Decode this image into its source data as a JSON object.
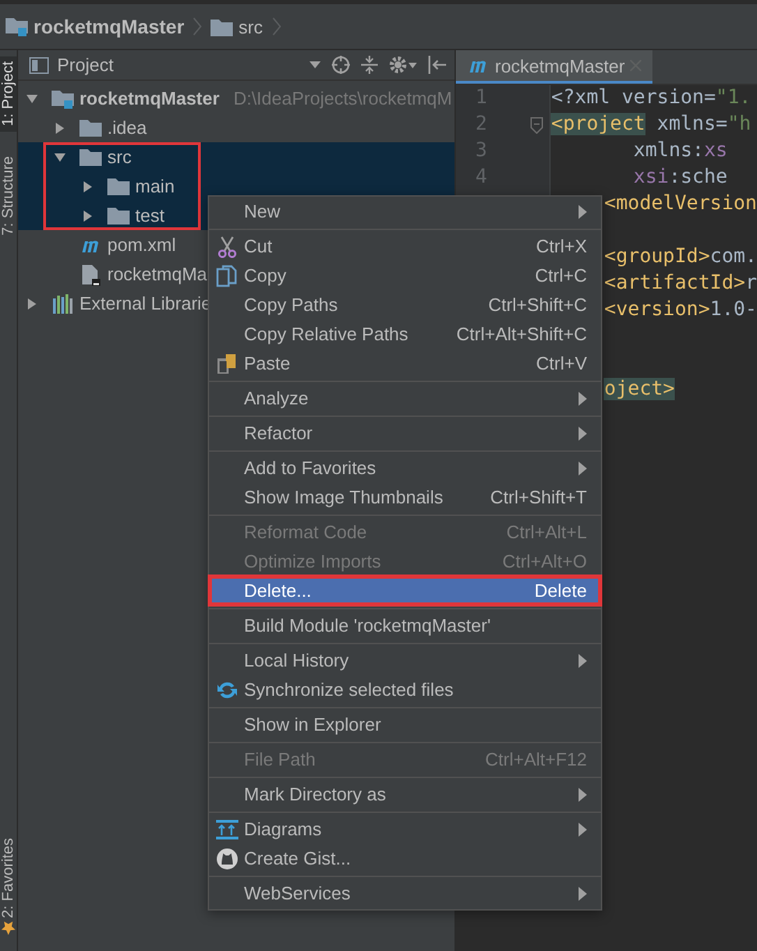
{
  "breadcrumb": [
    {
      "kind": "module",
      "label": "rocketmqMaster"
    },
    {
      "kind": "folder",
      "label": "src"
    }
  ],
  "tool_strip": [
    {
      "label": "1: Project",
      "selected": true,
      "kind": "project"
    },
    {
      "label": "7: Structure",
      "selected": false,
      "kind": "structure"
    },
    {
      "label": "2: Favorites",
      "selected": false,
      "kind": "favorites"
    }
  ],
  "project": {
    "title": "Project",
    "tree": [
      {
        "kind": "module",
        "label": "rocketmqMaster",
        "path": "D:\\IdeaProjects\\rocketmqM",
        "expanded": true,
        "selected": false,
        "children": [
          {
            "kind": "folder",
            "label": ".idea",
            "expanded": false,
            "selected": false
          },
          {
            "kind": "folder",
            "label": "src",
            "expanded": true,
            "selected": true,
            "annotated": true,
            "children": [
              {
                "kind": "folder",
                "label": "main",
                "expanded": false,
                "selected": true
              },
              {
                "kind": "folder",
                "label": "test",
                "expanded": false,
                "selected": true
              }
            ]
          },
          {
            "kind": "maven",
            "label": "pom.xml",
            "selected": false
          },
          {
            "kind": "iml",
            "label": "rocketmqMa",
            "selected": false
          }
        ]
      },
      {
        "kind": "libraries",
        "label": "External Librarie",
        "expanded": false,
        "selected": false
      }
    ]
  },
  "editor": {
    "tab": {
      "label": "rocketmqMaster",
      "selected": true
    },
    "lines": [
      {
        "number": "1",
        "segments": [
          {
            "kind": "plain",
            "text": "<?xml version="
          },
          {
            "kind": "string",
            "text": "\"1."
          }
        ]
      },
      {
        "number": "2",
        "fold": true,
        "segments": [
          {
            "kind": "tag",
            "text": "<project",
            "highlighted": true
          },
          {
            "kind": "plain",
            "text": " xmlns="
          },
          {
            "kind": "string",
            "text": "\"h"
          }
        ]
      },
      {
        "number": "3",
        "segments": [
          {
            "kind": "plain",
            "text": "       xmlns:"
          },
          {
            "kind": "ns",
            "text": "xs"
          }
        ]
      },
      {
        "number": "4",
        "segments": [
          {
            "kind": "ns",
            "text": "       xsi"
          },
          {
            "kind": "plain",
            "text": ":sche"
          }
        ]
      }
    ],
    "lines_beside_menu": [
      {
        "kind": "code",
        "segments": [
          {
            "kind": "tag",
            "text": "<modelVersion"
          }
        ]
      },
      {
        "kind": "blank"
      },
      {
        "kind": "code",
        "segments": [
          {
            "kind": "tag",
            "text": "<groupId>"
          },
          {
            "kind": "plain",
            "text": "com."
          }
        ]
      },
      {
        "kind": "code",
        "segments": [
          {
            "kind": "tag",
            "text": "<artifactId>"
          },
          {
            "kind": "plain",
            "text": "r"
          }
        ]
      },
      {
        "kind": "code",
        "segments": [
          {
            "kind": "tag",
            "text": "<version>"
          },
          {
            "kind": "plain",
            "text": "1.0-"
          }
        ]
      },
      {
        "kind": "blank"
      },
      {
        "kind": "blank"
      },
      {
        "kind": "code",
        "segments": [
          {
            "kind": "tag",
            "text": "oject>",
            "highlighted": true
          }
        ]
      }
    ]
  },
  "context_menu": {
    "items": [
      {
        "kind": "item",
        "label": "New",
        "submenu": true,
        "disabled": false,
        "selected": false
      },
      {
        "kind": "separator"
      },
      {
        "kind": "item",
        "label": "Cut",
        "shortcut": "Ctrl+X",
        "disabled": false,
        "selected": false
      },
      {
        "kind": "item",
        "label": "Copy",
        "shortcut": "Ctrl+C",
        "disabled": false,
        "selected": false
      },
      {
        "kind": "item",
        "label": "Copy Paths",
        "shortcut": "Ctrl+Shift+C",
        "disabled": false,
        "selected": false
      },
      {
        "kind": "item",
        "label": "Copy Relative Paths",
        "shortcut": "Ctrl+Alt+Shift+C",
        "disabled": false,
        "selected": false
      },
      {
        "kind": "item",
        "label": "Paste",
        "shortcut": "Ctrl+V",
        "disabled": false,
        "selected": false
      },
      {
        "kind": "separator"
      },
      {
        "kind": "item",
        "label": "Analyze",
        "submenu": true,
        "disabled": false,
        "selected": false
      },
      {
        "kind": "separator"
      },
      {
        "kind": "item",
        "label": "Refactor",
        "submenu": true,
        "disabled": false,
        "selected": false
      },
      {
        "kind": "separator"
      },
      {
        "kind": "item",
        "label": "Add to Favorites",
        "submenu": true,
        "disabled": false,
        "selected": false
      },
      {
        "kind": "item",
        "label": "Show Image Thumbnails",
        "shortcut": "Ctrl+Shift+T",
        "disabled": false,
        "selected": false
      },
      {
        "kind": "separator"
      },
      {
        "kind": "item",
        "label": "Reformat Code",
        "shortcut": "Ctrl+Alt+L",
        "disabled": true,
        "selected": false
      },
      {
        "kind": "item",
        "label": "Optimize Imports",
        "shortcut": "Ctrl+Alt+O",
        "disabled": true,
        "selected": false
      },
      {
        "kind": "item",
        "label": "Delete...",
        "shortcut": "Delete",
        "disabled": false,
        "selected": true,
        "annotated": true
      },
      {
        "kind": "separator"
      },
      {
        "kind": "item",
        "label": "Build Module 'rocketmqMaster'",
        "disabled": false,
        "selected": false
      },
      {
        "kind": "separator"
      },
      {
        "kind": "item",
        "label": "Local History",
        "submenu": true,
        "disabled": false,
        "selected": false
      },
      {
        "kind": "item",
        "label": "Synchronize selected files",
        "disabled": false,
        "selected": false
      },
      {
        "kind": "separator"
      },
      {
        "kind": "item",
        "label": "Show in Explorer",
        "disabled": false,
        "selected": false
      },
      {
        "kind": "separator"
      },
      {
        "kind": "item",
        "label": "File Path",
        "shortcut": "Ctrl+Alt+F12",
        "disabled": true,
        "selected": false
      },
      {
        "kind": "separator"
      },
      {
        "kind": "item",
        "label": "Mark Directory as",
        "submenu": true,
        "disabled": false,
        "selected": false
      },
      {
        "kind": "separator"
      },
      {
        "kind": "item",
        "label": "Diagrams",
        "submenu": true,
        "disabled": false,
        "selected": false
      },
      {
        "kind": "item",
        "label": "Create Gist...",
        "disabled": false,
        "selected": false
      },
      {
        "kind": "separator"
      },
      {
        "kind": "item",
        "label": "WebServices",
        "submenu": true,
        "disabled": false,
        "selected": false
      }
    ]
  }
}
